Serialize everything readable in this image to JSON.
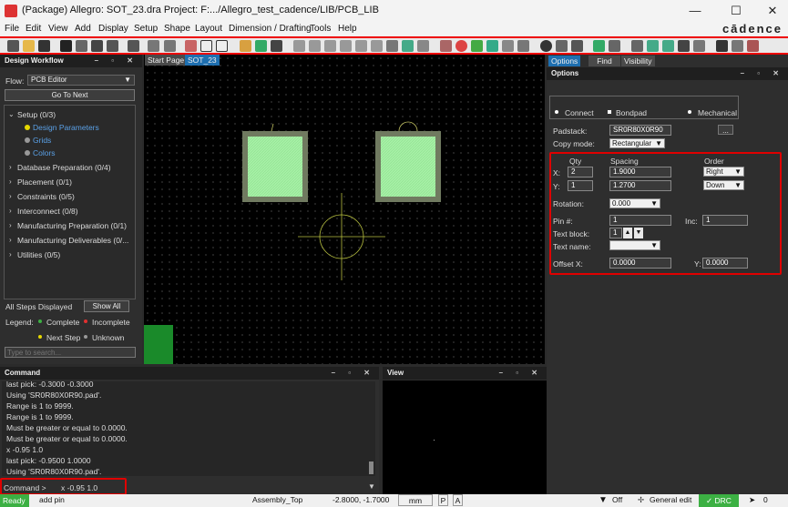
{
  "window": {
    "title": "(Package) Allegro: SOT_23.dra  Project: F:.../Allegro_test_cadence/LIB/PCB_LIB",
    "min": "—",
    "max": "☐",
    "close": "✕"
  },
  "menu": [
    "File",
    "Edit",
    "View",
    "Add",
    "Display",
    "Setup",
    "Shape",
    "Layout",
    "Dimension / Drafting",
    "Tools",
    "Help"
  ],
  "brand": "cādence",
  "workflow": {
    "title": "Design Workflow",
    "flow_label": "Flow:",
    "flow_value": "PCB Editor",
    "go_next": "Go To Next",
    "setup": "Setup  (0/3)",
    "setup_children": [
      "Design Parameters",
      "Grids",
      "Colors"
    ],
    "items": [
      "Database Preparation  (0/4)",
      "Placement  (0/1)",
      "Constraints  (0/5)",
      "Interconnect  (0/8)",
      "Manufacturing Preparation  (0/1)",
      "Manufacturing Deliverables  (0/...",
      "Utilities  (0/5)"
    ],
    "steps_displayed": "All Steps Displayed",
    "show_all": "Show All",
    "legend_label": "Legend:",
    "legend": [
      "Complete",
      "Incomplete",
      "Next Step",
      "Unknown"
    ],
    "search_placeholder": "Type to search..."
  },
  "canvas_tabs": [
    "Start Page",
    "SOT_23"
  ],
  "right_tabs": [
    "Options",
    "Find",
    "Visibility"
  ],
  "options": {
    "title": "Options",
    "radio_connect": "Connect",
    "check_bondpad": "Bondpad",
    "radio_mechanical": "Mechanical",
    "padstack_label": "Padstack:",
    "padstack_value": "SR0R80X0R90",
    "browse": "...",
    "copy_mode_label": "Copy mode:",
    "copy_mode_value": "Rectangular",
    "qty_label": "Qty",
    "spacing_label": "Spacing",
    "order_label": "Order",
    "x_label": "X:",
    "y_label": "Y:",
    "x_qty": "2",
    "x_spacing": "1.9000",
    "x_order": "Right",
    "y_qty": "1",
    "y_spacing": "1.2700",
    "y_order": "Down",
    "rotation_label": "Rotation:",
    "rotation_value": "0.000",
    "pin_label": "Pin #:",
    "pin_value": "1",
    "inc_label": "Inc:",
    "inc_value": "1",
    "textblock_label": "Text block:",
    "textblock_value": "1",
    "textname_label": "Text name:",
    "textname_value": "",
    "offset_x_label": "Offset X:",
    "offset_x_value": "0.0000",
    "offset_y_label": "Y:",
    "offset_y_value": "0.0000"
  },
  "command": {
    "title": "Command",
    "log": [
      "last pick:  -0.3000 -0.3000",
      "Using 'SR0R80X0R90.pad'.",
      "Range is 1 to 9999.",
      "Range is 1 to 9999.",
      "Must be greater or equal to 0.0000.",
      "Must be greater or equal to 0.0000.",
      "x -0.95 1.0",
      "last pick:  -0.9500 1.0000",
      "Using 'SR0R80X0R90.pad'."
    ],
    "prompt": "Command >",
    "input": "x -0.95 1.0"
  },
  "view": {
    "title": "View"
  },
  "status": {
    "ready": "Ready",
    "cmd": "add pin",
    "layer": "Assembly_Top",
    "coords": "-2.8000, -1.7000",
    "units": "mm",
    "p": "P",
    "a": "A",
    "filter": "Off",
    "mode": "General edit",
    "drc": "DRC",
    "count": "0"
  },
  "colors": {
    "accent": "#e00000",
    "pad_fill": "#a6f0a6",
    "pad_border": "#707a60",
    "ready_green": "#3cb043",
    "link_blue": "#5aa0e6"
  }
}
